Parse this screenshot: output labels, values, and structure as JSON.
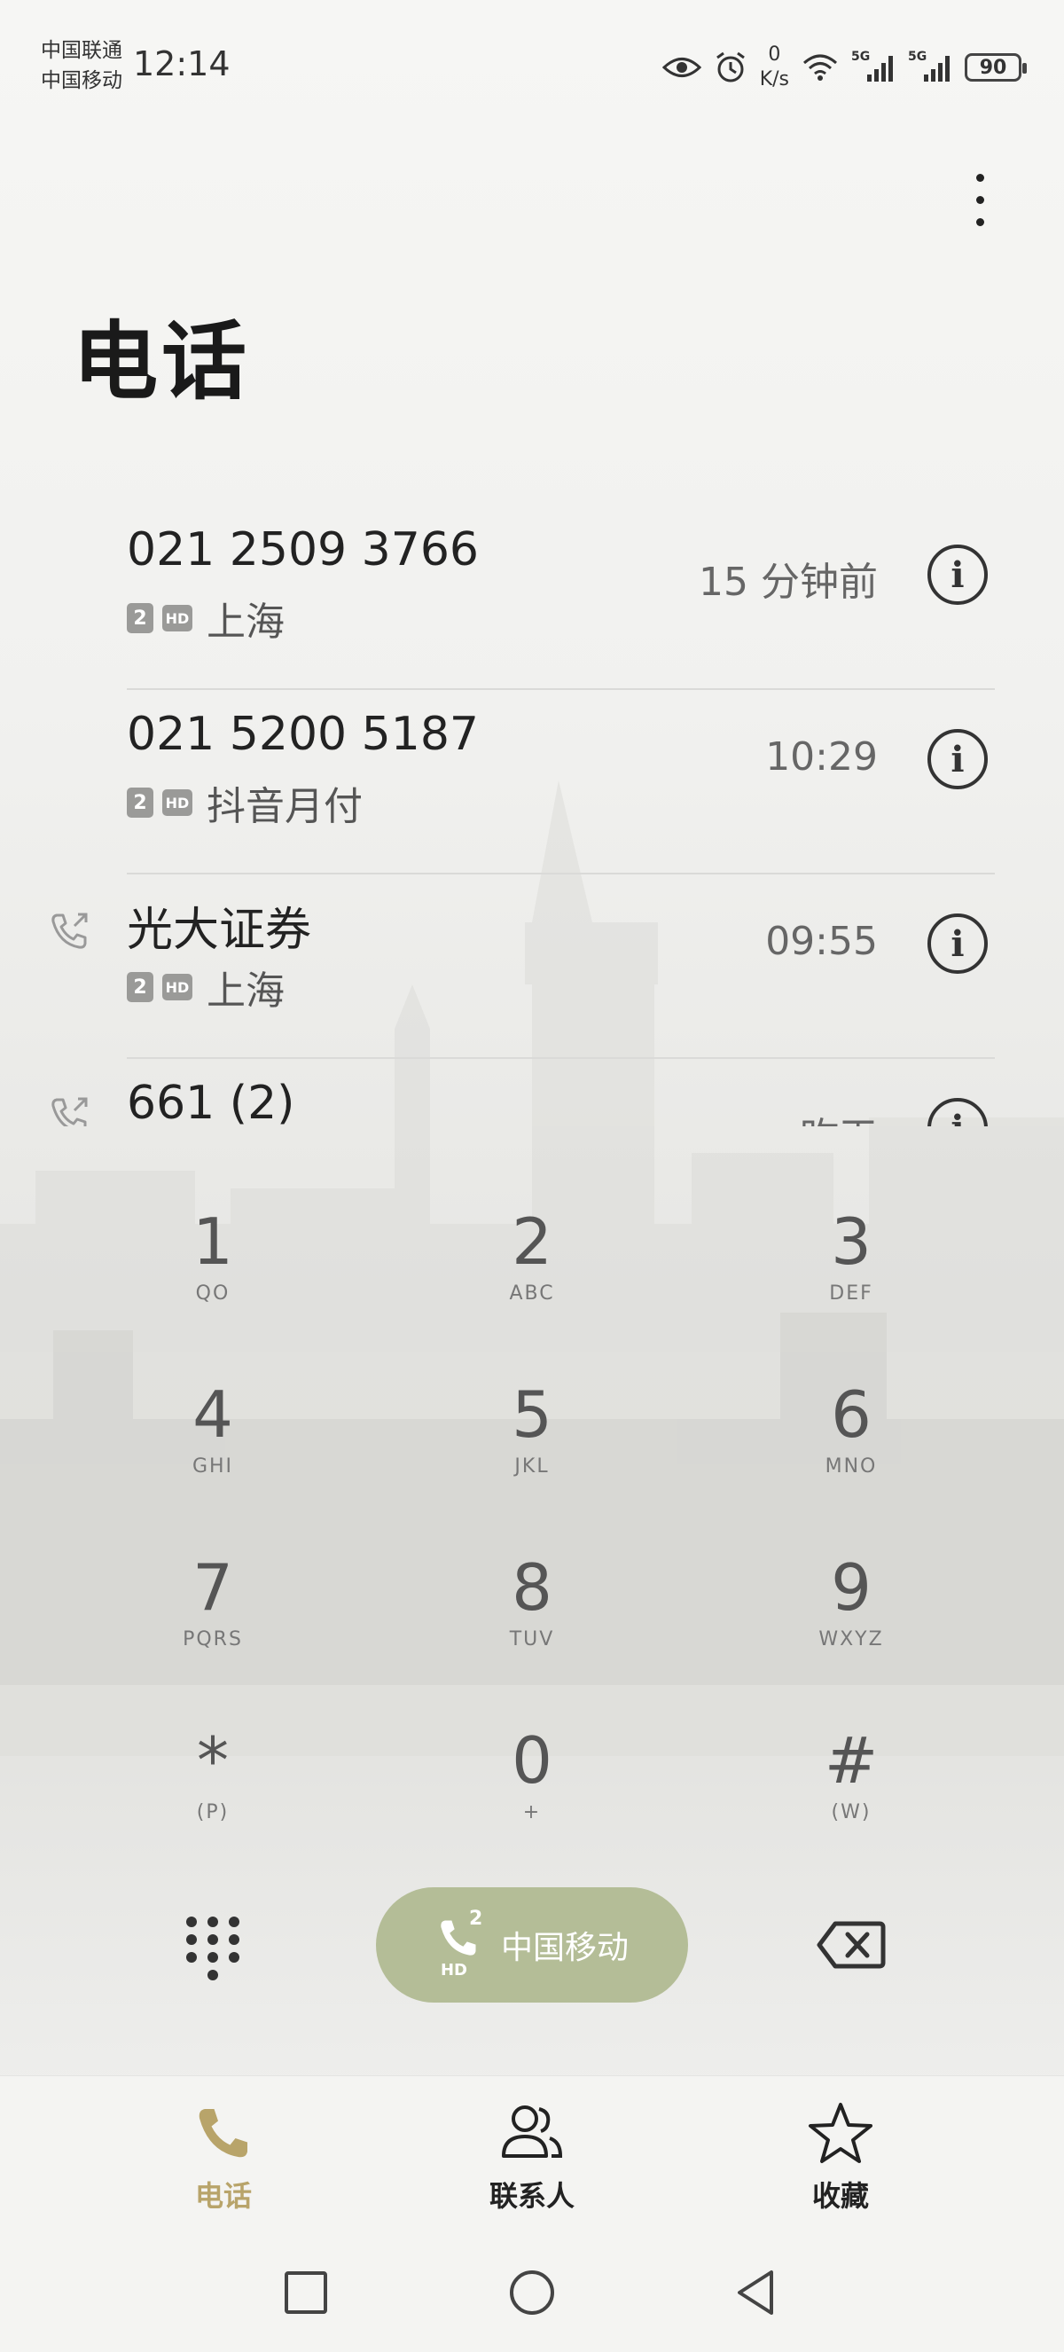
{
  "status_bar": {
    "carrier_1": "中国联通",
    "carrier_2": "中国移动",
    "time": "12:14",
    "net_speed_value": "0",
    "net_speed_unit": "K/s",
    "signal_1": "5G",
    "signal_2": "5G",
    "battery": "90"
  },
  "page_title": "电话",
  "call_log": [
    {
      "name": "021 2509 3766",
      "sim": "2",
      "hd": "HD",
      "location": "上海",
      "time": "15 分钟前",
      "outgoing": false
    },
    {
      "name": "021 5200 5187",
      "sim": "2",
      "hd": "HD",
      "location": "抖音月付",
      "time": "10:29",
      "outgoing": false
    },
    {
      "name": "光大证券",
      "sim": "2",
      "hd": "HD",
      "location": "上海",
      "time": "09:55",
      "outgoing": true
    },
    {
      "name": "661 (2)",
      "sim": "",
      "hd": "",
      "location": "",
      "time": "昨天",
      "outgoing": true
    }
  ],
  "dialpad": {
    "keys": [
      {
        "digit": "1",
        "letters": "QO"
      },
      {
        "digit": "2",
        "letters": "ABC"
      },
      {
        "digit": "3",
        "letters": "DEF"
      },
      {
        "digit": "4",
        "letters": "GHI"
      },
      {
        "digit": "5",
        "letters": "JKL"
      },
      {
        "digit": "6",
        "letters": "MNO"
      },
      {
        "digit": "7",
        "letters": "PQRS"
      },
      {
        "digit": "8",
        "letters": "TUV"
      },
      {
        "digit": "9",
        "letters": "WXYZ"
      },
      {
        "digit": "*",
        "letters": "(P)"
      },
      {
        "digit": "0",
        "letters": "+"
      },
      {
        "digit": "#",
        "letters": "(W)"
      }
    ]
  },
  "call_button": {
    "sim": "2",
    "hd": "HD",
    "label": "中国移动",
    "color": "#b4bd97"
  },
  "bottom_nav": {
    "tabs": [
      {
        "label": "电话",
        "icon": "phone-icon",
        "active": true
      },
      {
        "label": "联系人",
        "icon": "contacts-icon",
        "active": false
      },
      {
        "label": "收藏",
        "icon": "star-icon",
        "active": false
      }
    ],
    "active_color": "#b8a46a"
  }
}
